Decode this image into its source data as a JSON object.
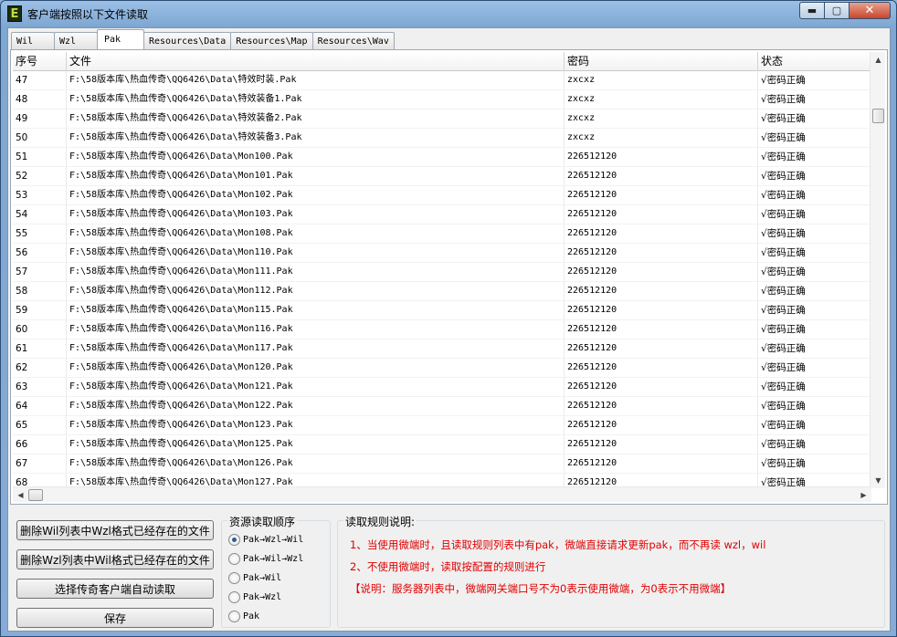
{
  "window": {
    "icon_letter": "E",
    "title": "客户端按照以下文件读取",
    "controls": {
      "minimize": "▬",
      "maximize": "▢",
      "close": "✕"
    }
  },
  "tabs": [
    {
      "label": "Wil",
      "active": false
    },
    {
      "label": "Wzl",
      "active": false
    },
    {
      "label": "Pak",
      "active": true
    },
    {
      "label": "Resources\\Data",
      "active": false
    },
    {
      "label": "Resources\\Map",
      "active": false
    },
    {
      "label": "Resources\\Wav",
      "active": false
    }
  ],
  "table": {
    "columns": [
      "序号",
      "文件",
      "密码",
      "状态"
    ],
    "rows": [
      [
        "47",
        "F:\\58版本库\\热血传奇\\QQ6426\\Data\\特效时装.Pak",
        "zxcxz",
        "√密码正确"
      ],
      [
        "48",
        "F:\\58版本库\\热血传奇\\QQ6426\\Data\\特效装备1.Pak",
        "zxcxz",
        "√密码正确"
      ],
      [
        "49",
        "F:\\58版本库\\热血传奇\\QQ6426\\Data\\特效装备2.Pak",
        "zxcxz",
        "√密码正确"
      ],
      [
        "50",
        "F:\\58版本库\\热血传奇\\QQ6426\\Data\\特效装备3.Pak",
        "zxcxz",
        "√密码正确"
      ],
      [
        "51",
        "F:\\58版本库\\热血传奇\\QQ6426\\Data\\Mon100.Pak",
        "226512120",
        "√密码正确"
      ],
      [
        "52",
        "F:\\58版本库\\热血传奇\\QQ6426\\Data\\Mon101.Pak",
        "226512120",
        "√密码正确"
      ],
      [
        "53",
        "F:\\58版本库\\热血传奇\\QQ6426\\Data\\Mon102.Pak",
        "226512120",
        "√密码正确"
      ],
      [
        "54",
        "F:\\58版本库\\热血传奇\\QQ6426\\Data\\Mon103.Pak",
        "226512120",
        "√密码正确"
      ],
      [
        "55",
        "F:\\58版本库\\热血传奇\\QQ6426\\Data\\Mon108.Pak",
        "226512120",
        "√密码正确"
      ],
      [
        "56",
        "F:\\58版本库\\热血传奇\\QQ6426\\Data\\Mon110.Pak",
        "226512120",
        "√密码正确"
      ],
      [
        "57",
        "F:\\58版本库\\热血传奇\\QQ6426\\Data\\Mon111.Pak",
        "226512120",
        "√密码正确"
      ],
      [
        "58",
        "F:\\58版本库\\热血传奇\\QQ6426\\Data\\Mon112.Pak",
        "226512120",
        "√密码正确"
      ],
      [
        "59",
        "F:\\58版本库\\热血传奇\\QQ6426\\Data\\Mon115.Pak",
        "226512120",
        "√密码正确"
      ],
      [
        "60",
        "F:\\58版本库\\热血传奇\\QQ6426\\Data\\Mon116.Pak",
        "226512120",
        "√密码正确"
      ],
      [
        "61",
        "F:\\58版本库\\热血传奇\\QQ6426\\Data\\Mon117.Pak",
        "226512120",
        "√密码正确"
      ],
      [
        "62",
        "F:\\58版本库\\热血传奇\\QQ6426\\Data\\Mon120.Pak",
        "226512120",
        "√密码正确"
      ],
      [
        "63",
        "F:\\58版本库\\热血传奇\\QQ6426\\Data\\Mon121.Pak",
        "226512120",
        "√密码正确"
      ],
      [
        "64",
        "F:\\58版本库\\热血传奇\\QQ6426\\Data\\Mon122.Pak",
        "226512120",
        "√密码正确"
      ],
      [
        "65",
        "F:\\58版本库\\热血传奇\\QQ6426\\Data\\Mon123.Pak",
        "226512120",
        "√密码正确"
      ],
      [
        "66",
        "F:\\58版本库\\热血传奇\\QQ6426\\Data\\Mon125.Pak",
        "226512120",
        "√密码正确"
      ],
      [
        "67",
        "F:\\58版本库\\热血传奇\\QQ6426\\Data\\Mon126.Pak",
        "226512120",
        "√密码正确"
      ],
      [
        "68",
        "F:\\58版本库\\热血传奇\\QQ6426\\Data\\Mon127.Pak",
        "226512120",
        "√密码正确"
      ]
    ]
  },
  "scrollbars": {
    "up": "▲",
    "down": "▼",
    "left": "◀",
    "right": "▶"
  },
  "buttons": {
    "delete_wil": "删除Wil列表中Wzl格式已经存在的文件",
    "delete_wzl": "删除Wzl列表中Wil格式已经存在的文件",
    "select_client": "选择传奇客户端自动读取",
    "save": "保存"
  },
  "order_group": {
    "title": "资源读取顺序",
    "options": [
      {
        "label": "Pak→Wzl→Wil",
        "selected": true
      },
      {
        "label": "Pak→Wil→Wzl",
        "selected": false
      },
      {
        "label": "Pak→Wil",
        "selected": false
      },
      {
        "label": "Pak→Wzl",
        "selected": false
      },
      {
        "label": "Pak",
        "selected": false
      }
    ]
  },
  "rules_group": {
    "title": "读取规则说明:",
    "lines": [
      "1、当使用微端时，且读取规则列表中有pak，微端直接请求更新pak，而不再读 wzl，wil",
      "2、不使用微端时，读取按配置的规则进行",
      "【说明：服务器列表中，微端网关端口号不为0表示使用微端，为0表示不用微端】"
    ],
    "text_color": "#e00000"
  }
}
